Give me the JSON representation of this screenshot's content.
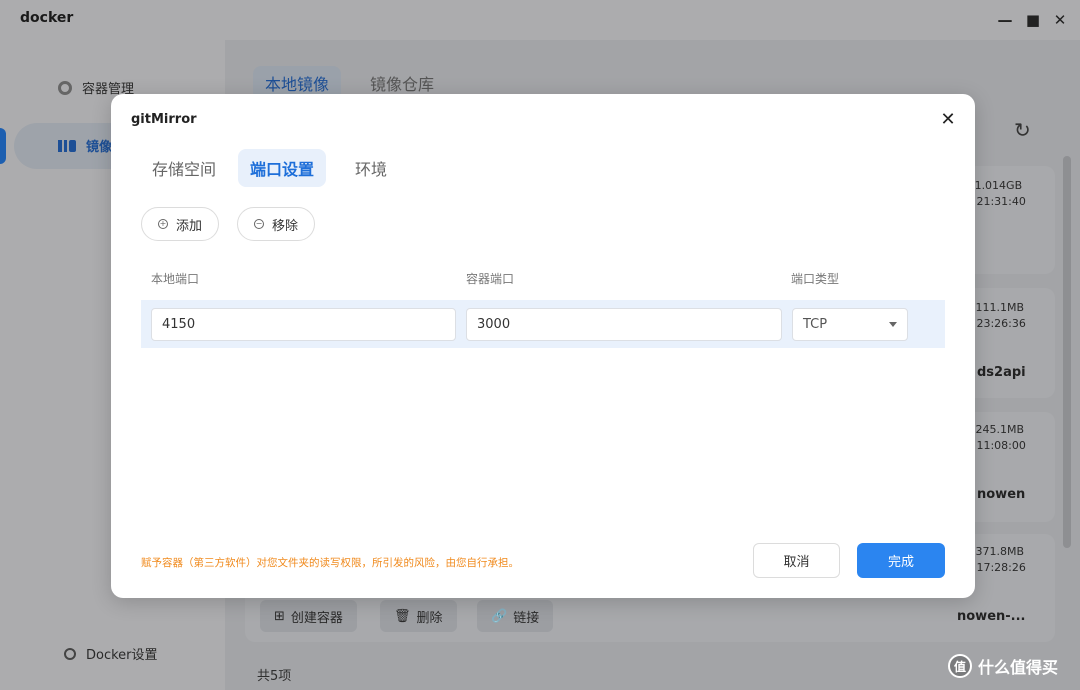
{
  "app": {
    "title": "docker",
    "window_controls": [
      "minimize-icon",
      "maximize-icon",
      "close-icon"
    ]
  },
  "sidebar": {
    "items": [
      {
        "label": "容器管理",
        "icon": "gear-icon",
        "active": false
      },
      {
        "label": "镜像",
        "icon": "image-icon",
        "active": true
      }
    ],
    "footer": {
      "label": "Docker设置",
      "icon": "settings-icon"
    }
  },
  "main": {
    "tabs": [
      {
        "label": "本地镜像",
        "active": true
      },
      {
        "label": "镜像仓库",
        "active": false
      }
    ],
    "cards": [
      {
        "info_line1": "GB 1.014GB",
        "info_line2": "-12 21:31:40",
        "name": ""
      },
      {
        "info_line1": "MB 111.1MB",
        "info_line2": "-04 23:26:36",
        "name": "ds2api"
      },
      {
        "info_line1": "MB 245.1MB",
        "info_line2": "-17 11:08:00",
        "name": "nowen"
      },
      {
        "info_line1": "MB 371.8MB",
        "info_line2": "-10 17:28:26",
        "name": "nowen-..."
      }
    ],
    "actions": [
      {
        "label": "创建容器",
        "icon": "create-container-icon"
      },
      {
        "label": "删除",
        "icon": "trash-icon"
      },
      {
        "label": "链接",
        "icon": "link-icon"
      }
    ],
    "total": "共5项"
  },
  "watermark": {
    "logo_text": "值",
    "text": "什么值得买"
  },
  "dialog": {
    "title": "gitMirror",
    "tabs": [
      {
        "label": "存储空间",
        "active": false
      },
      {
        "label": "端口设置",
        "active": true
      },
      {
        "label": "环境",
        "active": false
      }
    ],
    "add_label": "添加",
    "remove_label": "移除",
    "columns": [
      "本地端口",
      "容器端口",
      "端口类型"
    ],
    "rows": [
      {
        "local_port": "4150",
        "container_port": "3000",
        "type": "TCP"
      }
    ],
    "warning": "赋予容器（第三方软件）对您文件夹的读写权限，所引发的风险，由您自行承担。",
    "cancel_label": "取消",
    "ok_label": "完成"
  }
}
